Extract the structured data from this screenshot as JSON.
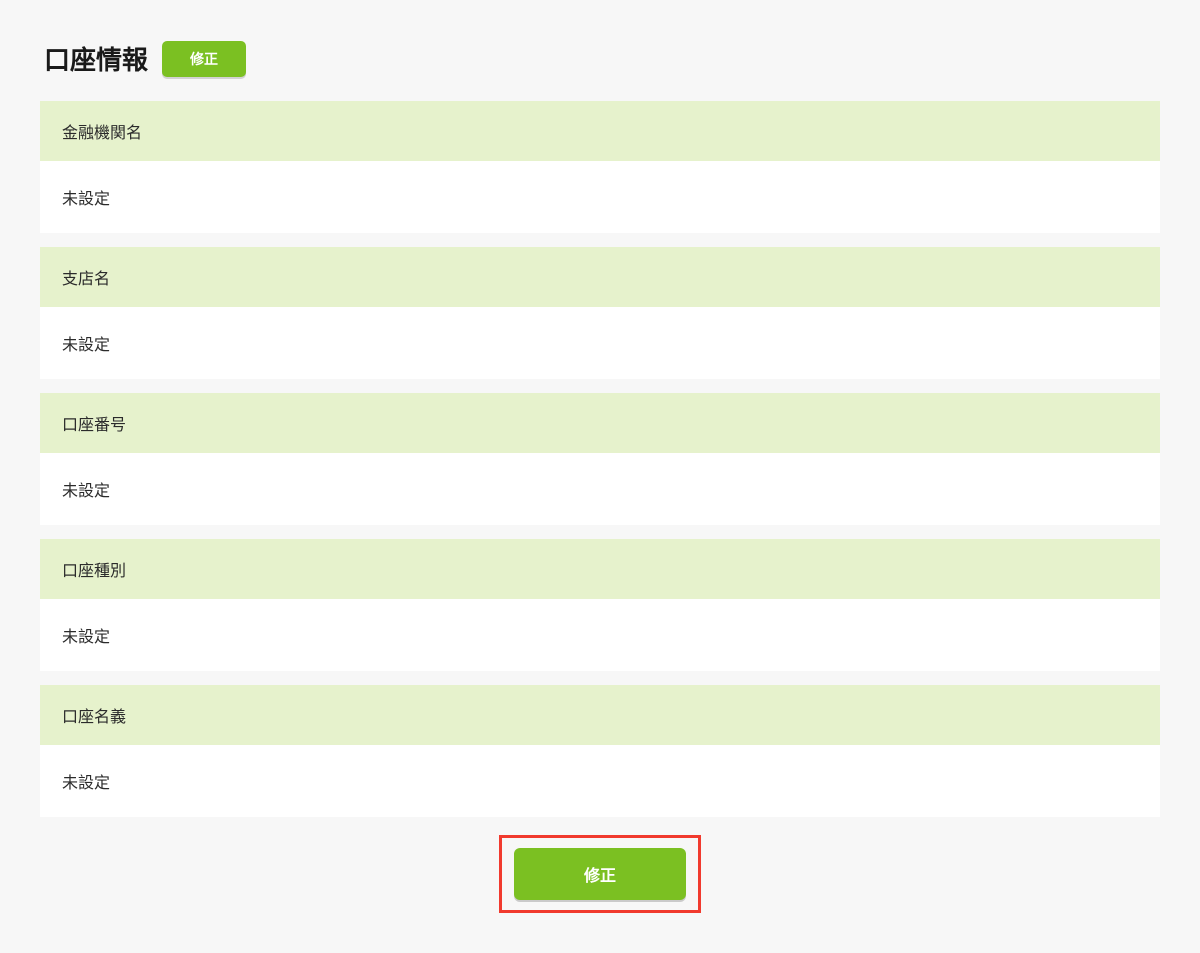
{
  "header": {
    "title": "口座情報",
    "edit_button_label": "修正"
  },
  "fields": [
    {
      "label": "金融機関名",
      "value": "未設定"
    },
    {
      "label": "支店名",
      "value": "未設定"
    },
    {
      "label": "口座番号",
      "value": "未設定"
    },
    {
      "label": "口座種別",
      "value": "未設定"
    },
    {
      "label": "口座名義",
      "value": "未設定"
    }
  ],
  "footer": {
    "edit_button_label": "修正"
  }
}
